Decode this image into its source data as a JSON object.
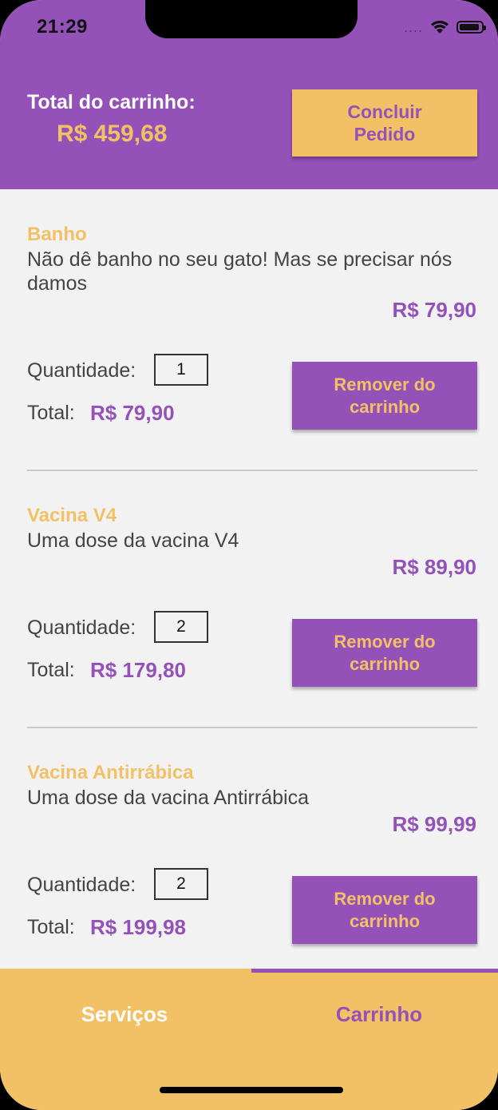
{
  "status_bar": {
    "time": "21:29",
    "signal": "....",
    "wifi_icon": "wifi-icon",
    "battery_icon": "battery-icon"
  },
  "header": {
    "total_label": "Total do carrinho:",
    "total_value": "R$ 459,68",
    "conclude_label": "Concluir\nPedido"
  },
  "items": [
    {
      "title": "Banho",
      "description": "Não dê banho no seu gato! Mas se precisar nós damos",
      "price": "R$ 79,90",
      "quantity_label": "Quantidade:",
      "quantity": "1",
      "total_label": "Total:",
      "total": "R$ 79,90",
      "remove_label": "Remover do\ncarrinho"
    },
    {
      "title": "Vacina V4",
      "description": "Uma dose da vacina V4",
      "price": "R$ 89,90",
      "quantity_label": "Quantidade:",
      "quantity": "2",
      "total_label": "Total:",
      "total": "R$ 179,80",
      "remove_label": "Remover do\ncarrinho"
    },
    {
      "title": "Vacina Antirrábica",
      "description": "Uma dose da vacina Antirrábica",
      "price": "R$ 99,99",
      "quantity_label": "Quantidade:",
      "quantity": "2",
      "total_label": "Total:",
      "total": "R$ 199,98",
      "remove_label": "Remover do\ncarrinho"
    }
  ],
  "tabbar": {
    "tabs": [
      {
        "label": "Serviços"
      },
      {
        "label": "Carrinho"
      }
    ],
    "active": "Carrinho"
  },
  "colors": {
    "primary": "#9452b9",
    "accent": "#f2c166",
    "background": "#f2f2f2"
  }
}
